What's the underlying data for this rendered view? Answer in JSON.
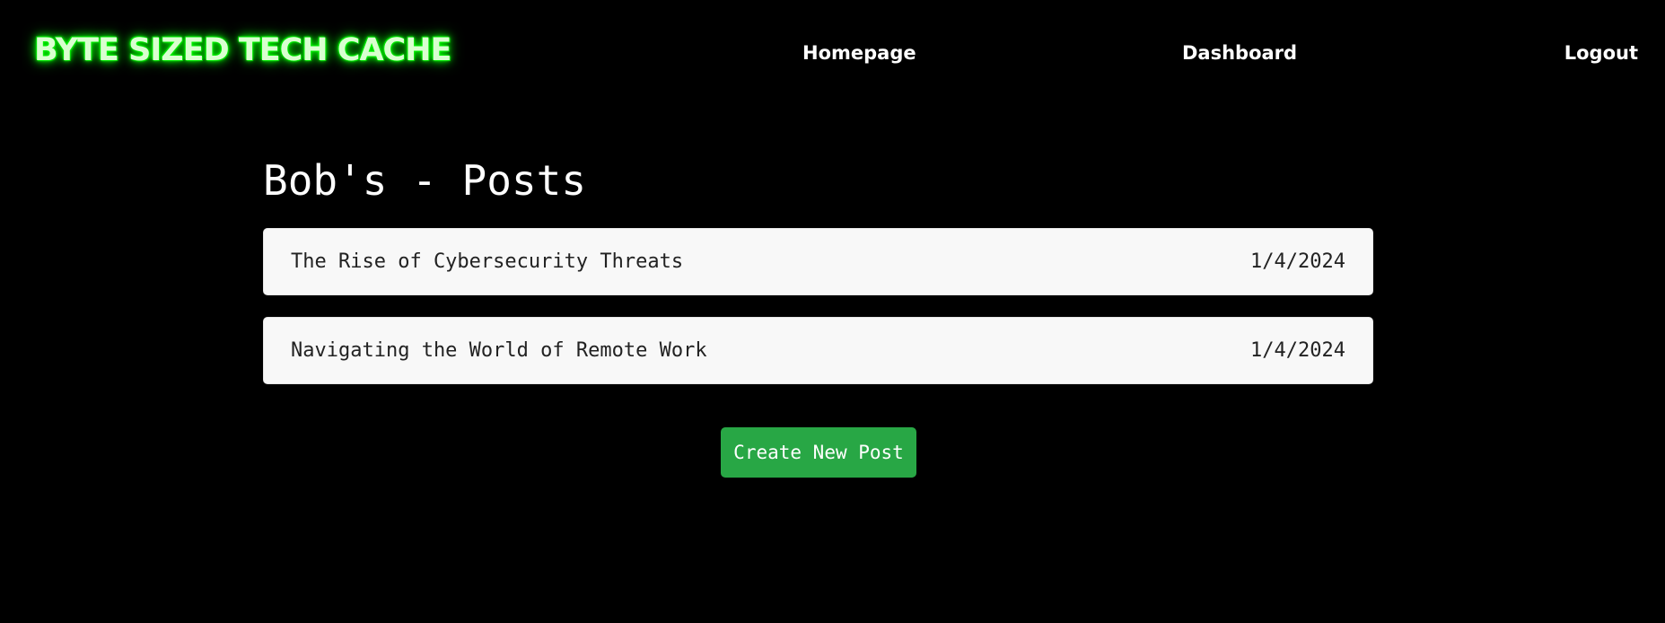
{
  "header": {
    "brand": "BYTE SIZED TECH  CACHE",
    "nav": {
      "homepage": "Homepage",
      "dashboard": "Dashboard",
      "logout": "Logout"
    }
  },
  "main": {
    "title": "Bob's - Posts",
    "posts": [
      {
        "title": "The Rise of Cybersecurity Threats",
        "date": "1/4/2024"
      },
      {
        "title": "Navigating the World of Remote Work",
        "date": "1/4/2024"
      }
    ],
    "create_button": "Create New Post"
  },
  "colors": {
    "background": "#000000",
    "brand_glow": "#00ff00",
    "card_background": "#f8f8f8",
    "button_green": "#28a745"
  }
}
